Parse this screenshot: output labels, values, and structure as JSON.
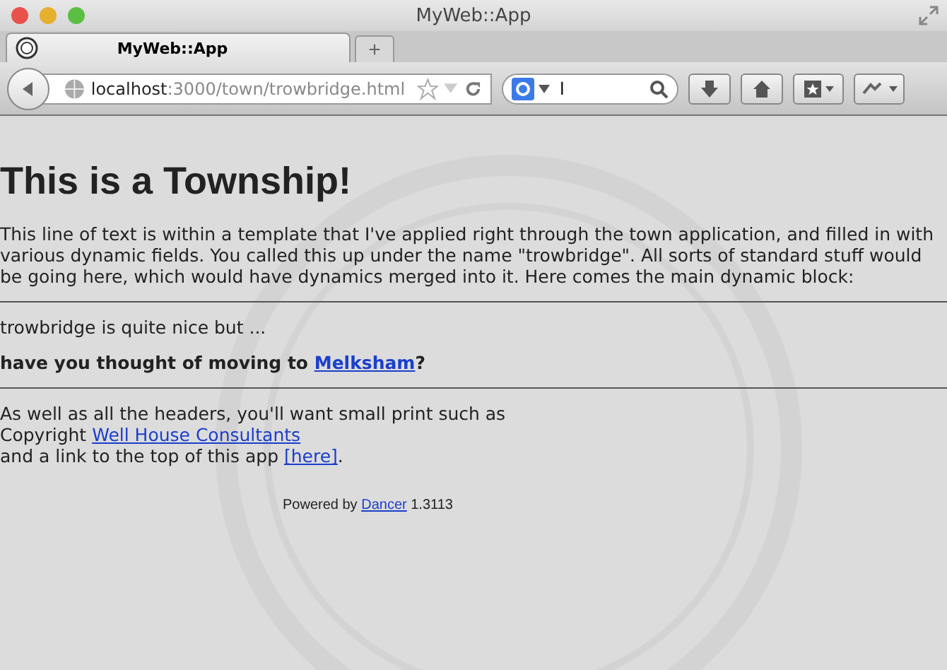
{
  "window": {
    "title": "MyWeb::App"
  },
  "tabs": [
    {
      "label": "MyWeb::App",
      "selected": true
    }
  ],
  "new_tab": {
    "label": "+"
  },
  "address_bar": {
    "host": "localhost",
    "rest": ":3000/town/trowbridge.html"
  },
  "search": {
    "value": "l"
  },
  "page": {
    "heading": "This is a Township!",
    "intro": "This line of text is within a template that I've applied right through the town application, and filled in with various dynamic fields. You called this up under the name \"trowbridge\". All sorts of standard stuff would be going here, which would have dynamics merged into it. Here comes the main dynamic block:",
    "dynamic_line": "trowbridge is quite nice but ...",
    "question": {
      "before": "have you thought of moving to ",
      "link": "Melksham",
      "after": "?"
    },
    "small_print": [
      {
        "text": "As well as all the headers, you'll want small print such as"
      },
      {
        "text": "Copyright ",
        "link": "Well House Consultants"
      },
      {
        "text": "and a link to the top of this app ",
        "link": "[here]",
        "after": "."
      }
    ],
    "footer": {
      "before": "Powered by ",
      "link": "Dancer",
      "after": " 1.3113"
    }
  }
}
